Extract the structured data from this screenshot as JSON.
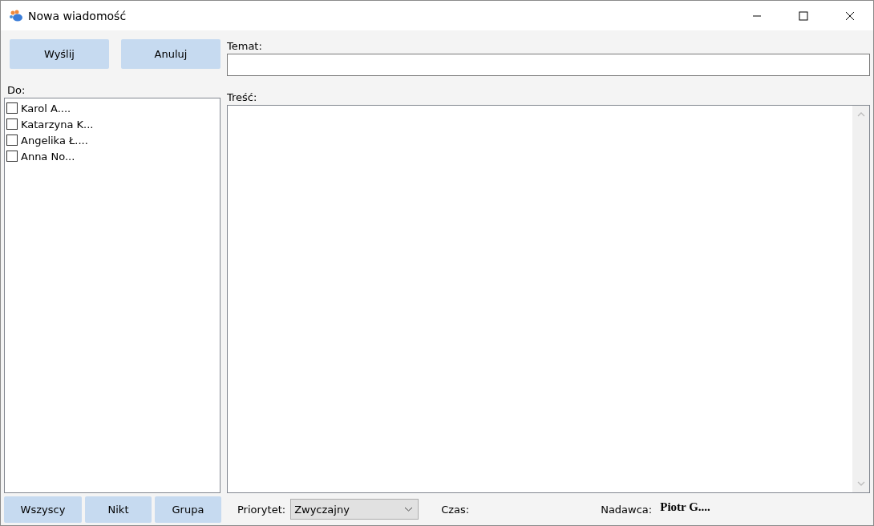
{
  "window": {
    "title": "Nowa wiadomość"
  },
  "actions": [
    {
      "label": "Wyślij"
    },
    {
      "label": "Anuluj"
    }
  ],
  "recipients": {
    "label": "Do:",
    "items": [
      {
        "name": "Karol A....",
        "checked": false
      },
      {
        "name": "Katarzyna K...",
        "checked": false
      },
      {
        "name": "Angelika Ł....",
        "checked": false
      },
      {
        "name": "Anna No...",
        "checked": false
      }
    ]
  },
  "select_buttons": [
    {
      "label": "Wszyscy"
    },
    {
      "label": "Nikt"
    },
    {
      "label": "Grupa"
    }
  ],
  "subject": {
    "label": "Temat:"
  },
  "body": {
    "label": "Treść:"
  },
  "footer": {
    "priority_label": "Priorytet:",
    "priority": "Zwyczajny",
    "time_label": "Czas:",
    "sender_label": "Nadawca:",
    "sender": "Piotr G...."
  }
}
